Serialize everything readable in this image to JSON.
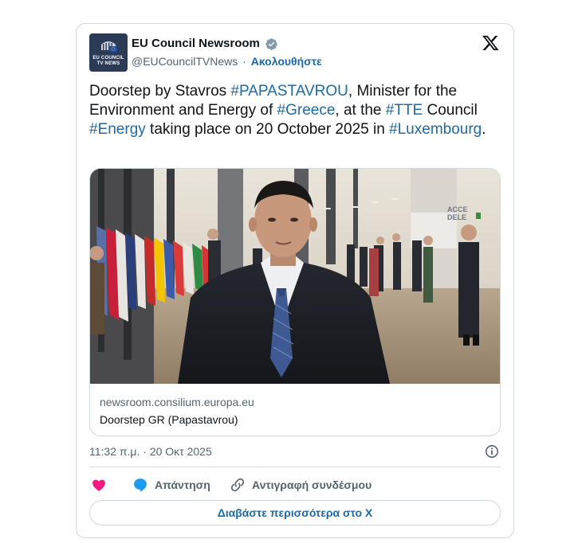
{
  "author": {
    "display_name": "EU Council Newsroom",
    "handle": "@EUCouncilTVNews",
    "separator": "·",
    "follow_label": "Ακολουθήστε",
    "avatar_text": [
      "EU COUNCIL",
      "TV NEWS"
    ]
  },
  "tweet": {
    "segments": [
      {
        "text": "Doorstep by Stavros ",
        "hashtag": false
      },
      {
        "text": "#PAPASTAVROU",
        "hashtag": true
      },
      {
        "text": ", Minister for the Environment and Energy of ",
        "hashtag": false
      },
      {
        "text": "#Greece",
        "hashtag": true
      },
      {
        "text": ", at the ",
        "hashtag": false
      },
      {
        "text": "#TTE",
        "hashtag": true
      },
      {
        "text": " Council ",
        "hashtag": false
      },
      {
        "text": "#Energy",
        "hashtag": true
      },
      {
        "text": " taking place on 20 October 2025 in ",
        "hashtag": false
      },
      {
        "text": "#Luxembourg",
        "hashtag": true
      },
      {
        "text": ".",
        "hashtag": false
      }
    ]
  },
  "card": {
    "domain": "newsroom.consilium.europa.eu",
    "title": "Doorstep GR (Papastavrou)",
    "photo_sign": [
      "ACCE",
      "DELE"
    ]
  },
  "meta": {
    "timestamp": "11:32 π.μ. · 20 Οκτ 2025"
  },
  "actions": {
    "reply_label": "Απάντηση",
    "copy_link_label": "Αντιγραφή συνδέσμου"
  },
  "read_more_label": "Διαβάστε περισσότερα στο X",
  "colors": {
    "link": "#1d6aa5",
    "heart": "#f91880",
    "reply_icon": "#1d9bf0",
    "verified": "#829aab",
    "muted_text": "#536471",
    "border": "#cfd9de"
  },
  "icons": [
    "x-logo-icon",
    "verified-badge-icon",
    "info-icon",
    "heart-icon",
    "reply-bubble-icon",
    "link-icon"
  ]
}
